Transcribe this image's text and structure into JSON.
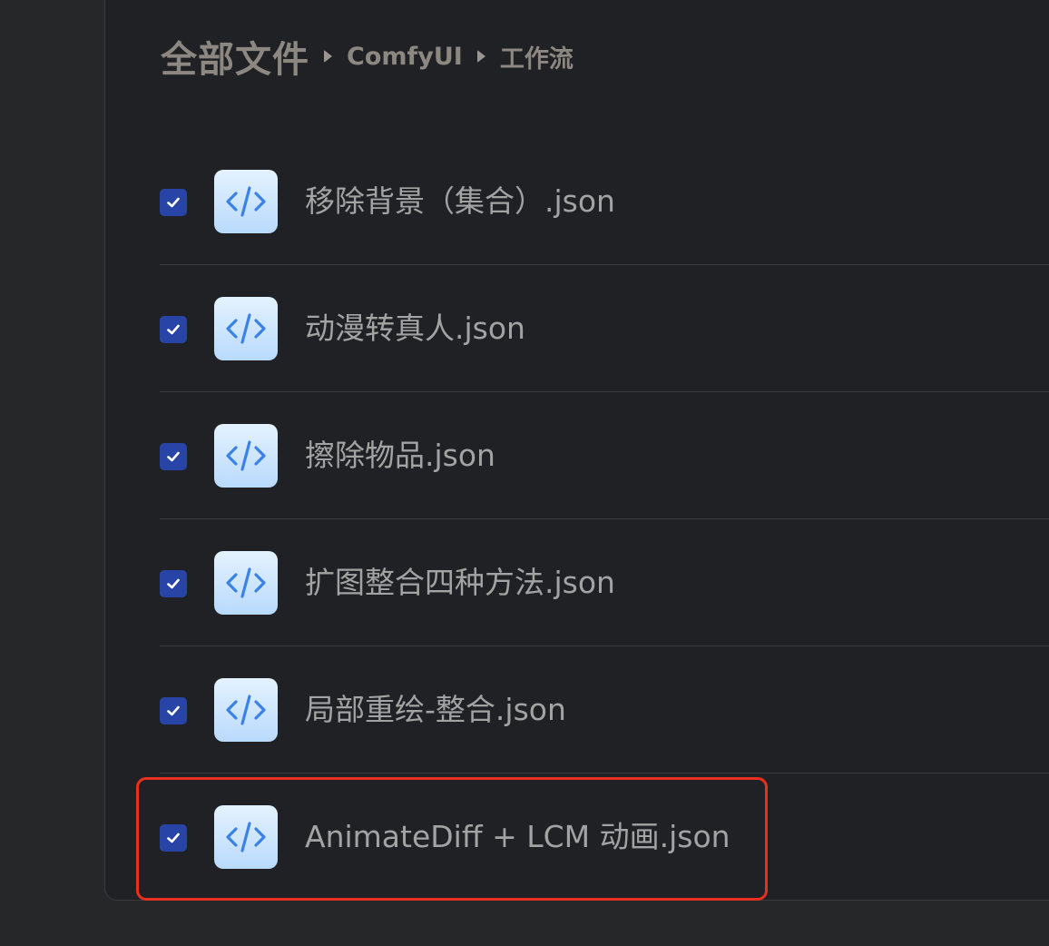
{
  "breadcrumb": {
    "root": "全部文件",
    "folder": "ComfyUI",
    "current": "工作流"
  },
  "files": [
    {
      "name": "移除背景（集合）.json",
      "checked": true,
      "icon": "code-file-icon"
    },
    {
      "name": "动漫转真人.json",
      "checked": true,
      "icon": "code-file-icon"
    },
    {
      "name": "擦除物品.json",
      "checked": true,
      "icon": "code-file-icon"
    },
    {
      "name": "扩图整合四种方法.json",
      "checked": true,
      "icon": "code-file-icon"
    },
    {
      "name": "局部重绘-整合.json",
      "checked": true,
      "icon": "code-file-icon"
    },
    {
      "name": "AnimateDiff + LCM 动画.json",
      "checked": true,
      "icon": "code-file-icon"
    }
  ],
  "colors": {
    "checkbox": "#2744a6",
    "highlight": "#e8301f",
    "icon_stroke": "#3b82e8"
  }
}
